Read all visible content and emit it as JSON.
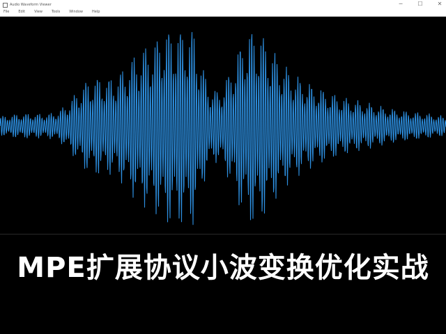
{
  "window": {
    "title": "Audio Waveform Viewer",
    "menu": [
      "File",
      "Edit",
      "View",
      "Tools",
      "Window",
      "Help"
    ],
    "controls": {
      "minimize": "─",
      "maximize": "☐",
      "close": "✕"
    }
  },
  "waveform": {
    "color": "#2d8fe0",
    "background": "#000000"
  },
  "caption": {
    "text": "MPE扩展协议小波变换优化实战"
  }
}
